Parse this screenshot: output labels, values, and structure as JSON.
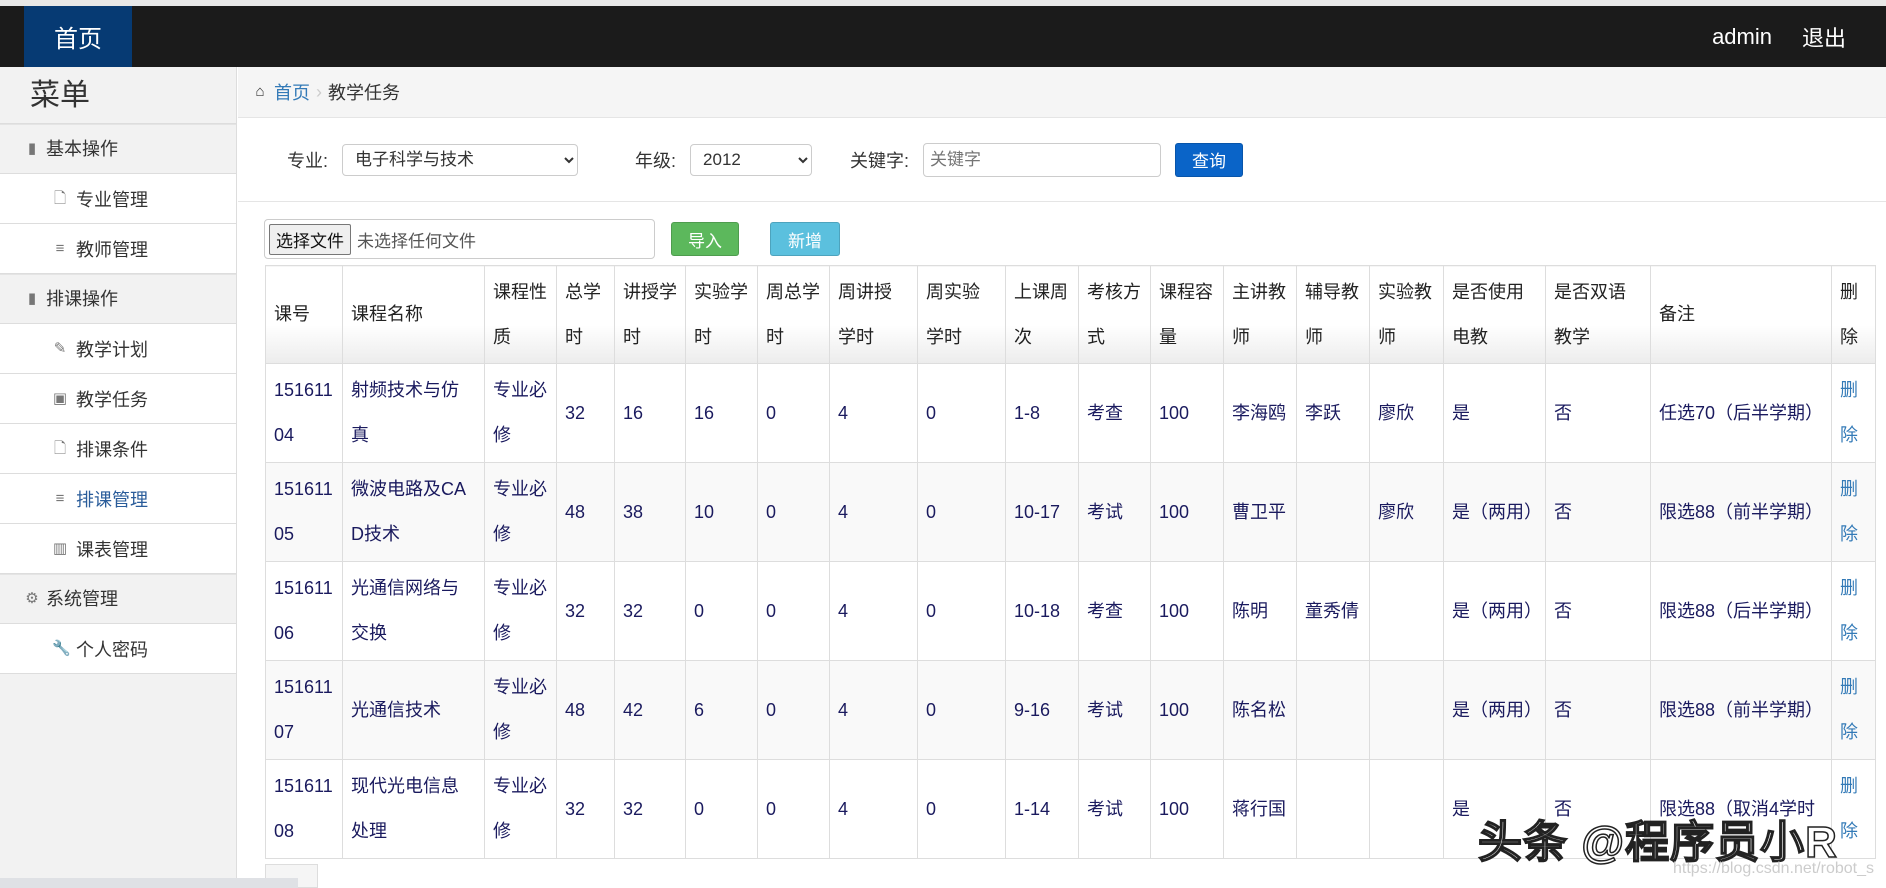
{
  "nav": {
    "home": "首页",
    "user": "admin",
    "logout": "退出"
  },
  "sidebar": {
    "title": "菜单",
    "groups": [
      {
        "label": "基本操作",
        "icon": "book-icon",
        "items": [
          {
            "label": "专业管理",
            "icon": "file-icon"
          },
          {
            "label": "教师管理",
            "icon": "list-icon"
          }
        ]
      },
      {
        "label": "排课操作",
        "icon": "book-icon",
        "items": [
          {
            "label": "教学计划",
            "icon": "plug-icon"
          },
          {
            "label": "教学任务",
            "icon": "picture-icon"
          },
          {
            "label": "排课条件",
            "icon": "file-icon"
          },
          {
            "label": "排课管理",
            "icon": "list-icon",
            "active": true
          },
          {
            "label": "课表管理",
            "icon": "books-icon"
          }
        ]
      },
      {
        "label": "系统管理",
        "icon": "gear-icon",
        "items": [
          {
            "label": "个人密码",
            "icon": "wrench-icon"
          }
        ]
      }
    ]
  },
  "breadcrumb": {
    "home": "首页",
    "current": "教学任务"
  },
  "filters": {
    "major_label": "专业:",
    "major_value": "电子科学与技术",
    "grade_label": "年级:",
    "grade_value": "2012",
    "keyword_label": "关键字:",
    "keyword_placeholder": "关键字",
    "query": "查询"
  },
  "actions": {
    "choose_file": "选择文件",
    "no_file": "未选择任何文件",
    "import": "导入",
    "add": "新增"
  },
  "table": {
    "headers": [
      "课号",
      "课程名称",
      "课程性质",
      "总学时",
      "讲授学时",
      "实验学时",
      "周总学时",
      "周讲授学时",
      "周实验学时",
      "上课周次",
      "考核方式",
      "课程容量",
      "主讲教师",
      "辅导教师",
      "实验教师",
      "是否使用电教",
      "是否双语教学",
      "备注",
      "删除"
    ],
    "rows": [
      [
        "15161104",
        "射频技术与仿真",
        "专业必修",
        "32",
        "16",
        "16",
        "0",
        "4",
        "0",
        "1-8",
        "考查",
        "100",
        "李海鸥",
        "李跃",
        "廖欣",
        "是",
        "否",
        "任选70（后半学期）",
        "删除"
      ],
      [
        "15161105",
        "微波电路及CAD技术",
        "专业必修",
        "48",
        "38",
        "10",
        "0",
        "4",
        "0",
        "10-17",
        "考试",
        "100",
        "曹卫平",
        "",
        "廖欣",
        "是（两用）",
        "否",
        "限选88（前半学期）",
        "删除"
      ],
      [
        "15161106",
        "光通信网络与交换",
        "专业必修",
        "32",
        "32",
        "0",
        "0",
        "4",
        "0",
        "10-18",
        "考查",
        "100",
        "陈明",
        "童秀倩",
        "",
        "是（两用）",
        "否",
        "限选88（后半学期）",
        "删除"
      ],
      [
        "15161107",
        "光通信技术",
        "专业必修",
        "48",
        "42",
        "6",
        "0",
        "4",
        "0",
        "9-16",
        "考试",
        "100",
        "陈名松",
        "",
        "",
        "是（两用）",
        "否",
        "限选88（前半学期）",
        "删除"
      ],
      [
        "15161108",
        "现代光电信息处理",
        "专业必修",
        "32",
        "32",
        "0",
        "0",
        "4",
        "0",
        "1-14",
        "考试",
        "100",
        "蒋行国",
        "",
        "",
        "是",
        "否",
        "限选88（取消4学时",
        "删除"
      ]
    ]
  },
  "watermark": {
    "text": "头条 @程序员小R",
    "url": "https://blog.csdn.net/robot_s"
  },
  "colors": {
    "navbar": "#1b1b1b",
    "home": "#063a73",
    "query": "#0a64c8",
    "import": "#5cb85c",
    "add": "#5bc0de",
    "link": "#337ab7"
  }
}
